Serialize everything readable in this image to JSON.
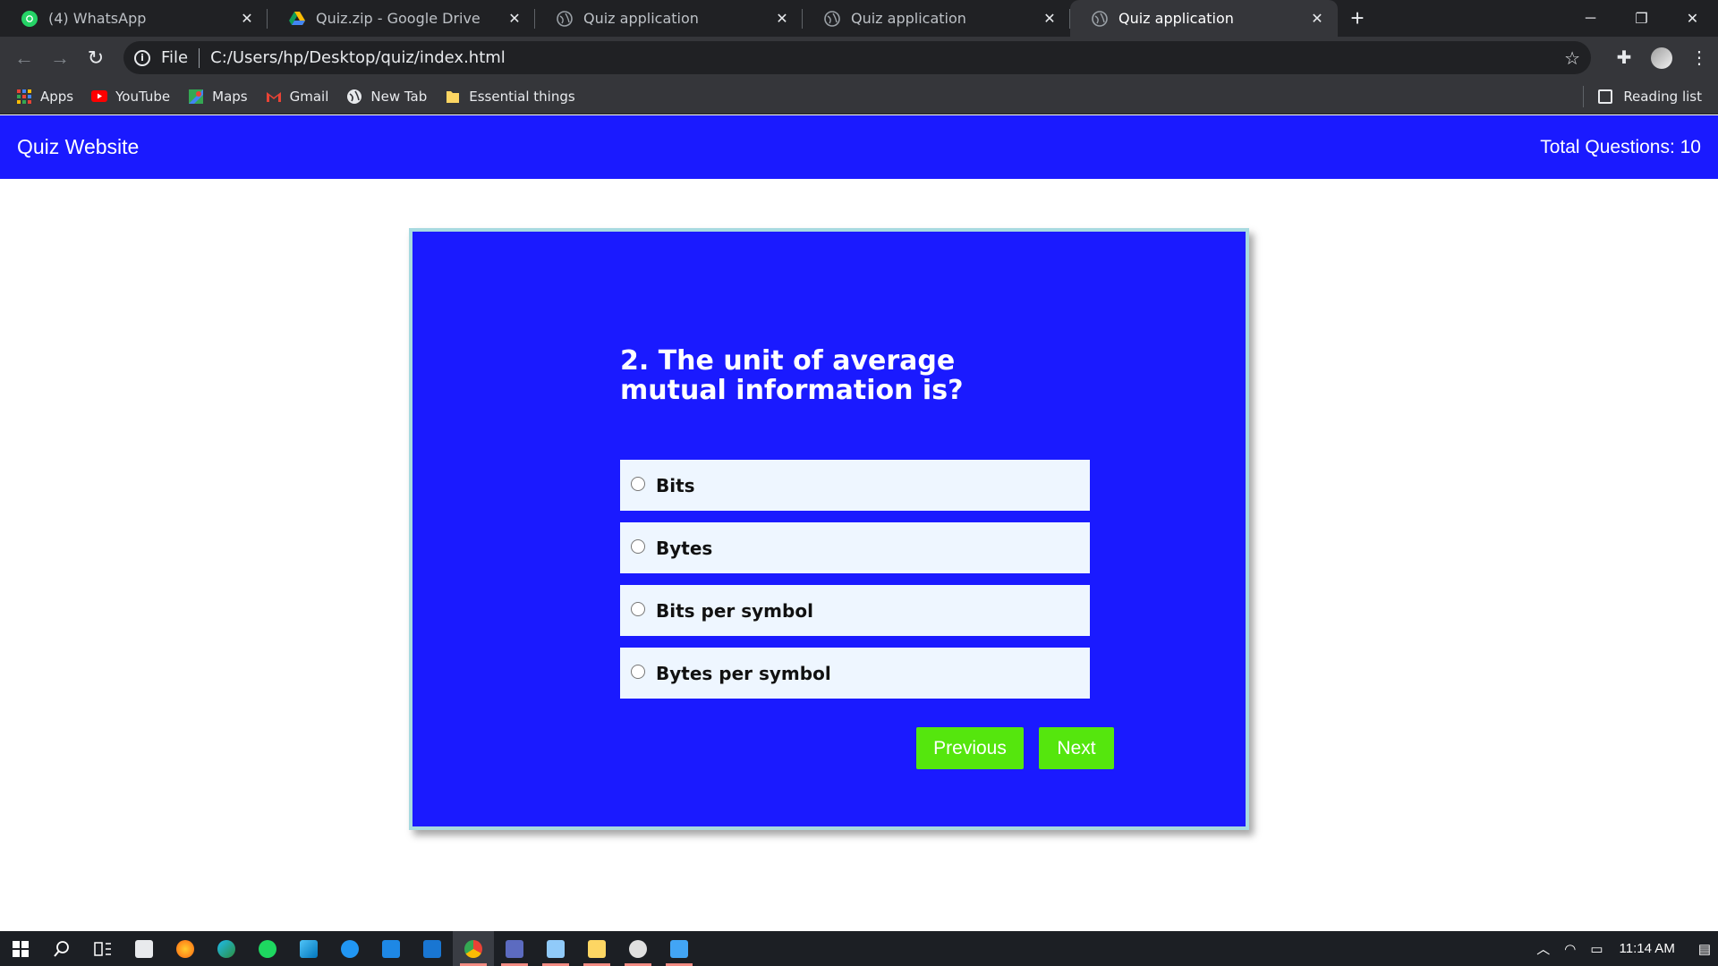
{
  "browser": {
    "tabs": [
      {
        "title": "(4) WhatsApp",
        "icon": "whatsapp-icon",
        "active": false,
        "color": "#25d366"
      },
      {
        "title": "Quiz.zip - Google Drive",
        "icon": "google-drive-icon",
        "active": false,
        "color": "#fbbc04"
      },
      {
        "title": "Quiz application",
        "icon": "globe-icon",
        "active": false,
        "color": "#9aa0a6"
      },
      {
        "title": "Quiz application",
        "icon": "globe-icon",
        "active": false,
        "color": "#9aa0a6"
      },
      {
        "title": "Quiz application",
        "icon": "globe-icon",
        "active": true,
        "color": "#9aa0a6"
      }
    ],
    "address": {
      "scheme": "File",
      "url": "C:/Users/hp/Desktop/quiz/index.html"
    },
    "bookmarks": [
      {
        "label": "Apps",
        "icon": "apps-grid-icon"
      },
      {
        "label": "YouTube",
        "icon": "youtube-icon"
      },
      {
        "label": "Maps",
        "icon": "maps-icon"
      },
      {
        "label": "Gmail",
        "icon": "gmail-icon"
      },
      {
        "label": "New Tab",
        "icon": "globe-icon"
      },
      {
        "label": "Essential things",
        "icon": "folder-icon"
      }
    ],
    "reading_list": "Reading list"
  },
  "site": {
    "title": "Quiz Website",
    "total_questions": "Total Questions: 10",
    "accent_color": "#1a1aff",
    "button_color": "#55e60d"
  },
  "quiz": {
    "question": "2. The unit of average mutual information is?",
    "options": [
      {
        "label": "Bits",
        "selected": false
      },
      {
        "label": "Bytes",
        "selected": false
      },
      {
        "label": "Bits per symbol",
        "selected": false
      },
      {
        "label": "Bytes per symbol",
        "selected": false
      }
    ],
    "previous_label": "Previous",
    "next_label": "Next"
  },
  "taskbar": {
    "time": "11:14 AM"
  }
}
